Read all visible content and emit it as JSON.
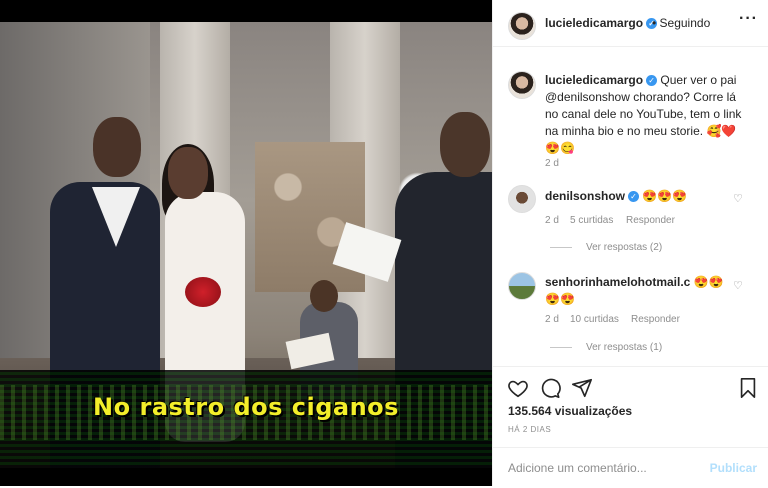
{
  "video": {
    "caption": "No rastro dos ciganos"
  },
  "header": {
    "username": "lucieledicamargo",
    "follow_status": "• Seguindo",
    "more_icon": "more-dots-icon"
  },
  "caption_comment": {
    "username": "lucieledicamargo",
    "text": "Quer ver o pai @denilsonshow chorando? Corre lá no canal dele no YouTube, tem o link na minha bio e no meu storie.",
    "emojis": "🥰❤️😍😋",
    "time": "2 d"
  },
  "comments": [
    {
      "username": "denilsonshow",
      "text": "😍😍😍",
      "time": "2 d",
      "likes": "5 curtidas",
      "reply": "Responder",
      "view_replies": "Ver respostas (2)"
    },
    {
      "username": "senhorinhamelohotmail.c",
      "text": "😍😍😍😍",
      "time": "2 d",
      "likes": "10 curtidas",
      "reply": "Responder",
      "view_replies": "Ver respostas (1)"
    }
  ],
  "actions": {
    "icons": [
      "heart-icon",
      "comment-icon",
      "share-icon",
      "bookmark-icon"
    ],
    "views": "135.564 visualizações",
    "posted_ago": "HÁ 2 DIAS"
  },
  "comment_box": {
    "placeholder": "Adicione um comentário...",
    "publish_label": "Publicar"
  },
  "colors": {
    "verified": "#3897f0",
    "caption_text": "#f3ee2a",
    "publish": "#b2dffc"
  }
}
